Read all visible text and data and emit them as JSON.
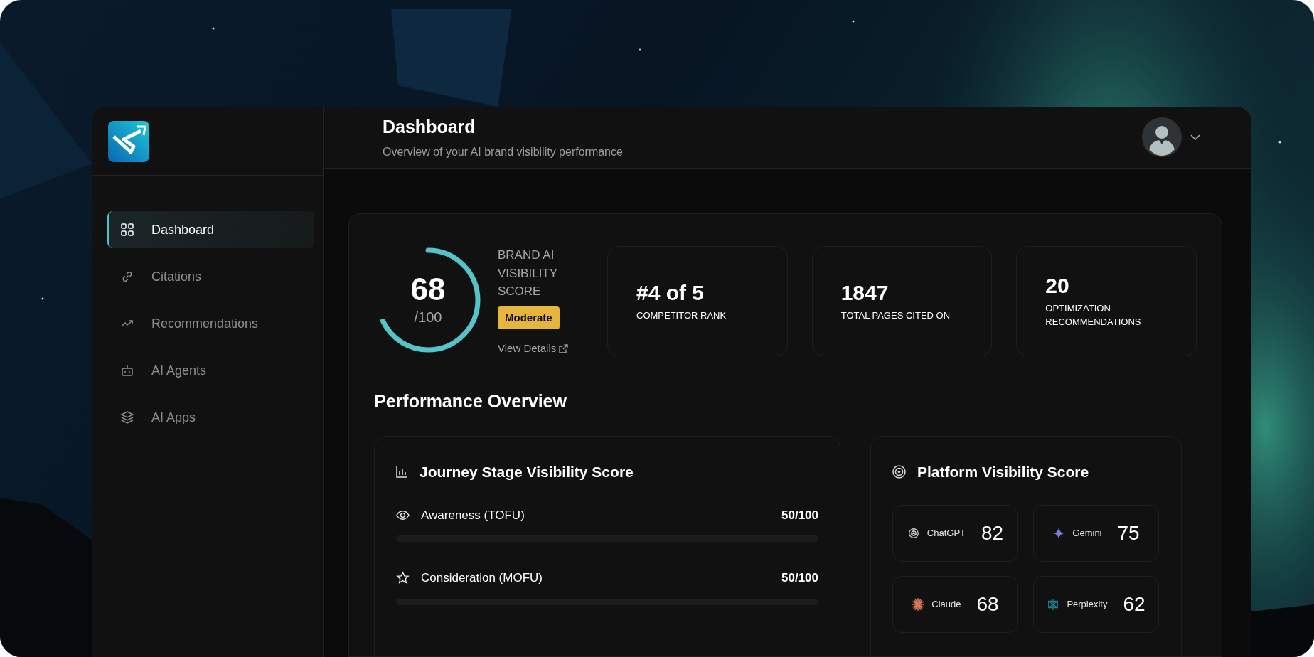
{
  "header": {
    "title": "Dashboard",
    "subtitle": "Overview of your AI brand visibility performance"
  },
  "sidebar": {
    "items": [
      {
        "label": "Dashboard",
        "selected": true
      },
      {
        "label": "Citations",
        "selected": false
      },
      {
        "label": "Recommendations",
        "selected": false
      },
      {
        "label": "AI Agents",
        "selected": false
      },
      {
        "label": "AI Apps",
        "selected": false
      }
    ]
  },
  "score": {
    "value": "68",
    "max": "/100",
    "level": 0.68,
    "label": "BRAND AI VISIBILITY SCORE",
    "badge": "Moderate",
    "link": "View Details"
  },
  "stats": [
    {
      "value": "#4 of 5",
      "label": "COMPETITOR RANK"
    },
    {
      "value": "1847",
      "label": "TOTAL PAGES CITED ON"
    },
    {
      "value": "20",
      "label": "OPTIMIZATION RECOMMENDATIONS"
    }
  ],
  "section_title": "Performance Overview",
  "journey": {
    "title": "Journey Stage Visibility Score",
    "stages": [
      {
        "label": "Awareness (TOFU)",
        "reading": "50/100"
      },
      {
        "label": "Consideration (MOFU)",
        "reading": "50/100"
      }
    ]
  },
  "platforms": {
    "title": "Platform Visibility Score",
    "items": [
      {
        "name": "ChatGPT",
        "score": "82"
      },
      {
        "name": "Gemini",
        "score": "75"
      },
      {
        "name": "Claude",
        "score": "68"
      },
      {
        "name": "Perplexity",
        "score": "62"
      }
    ]
  }
}
